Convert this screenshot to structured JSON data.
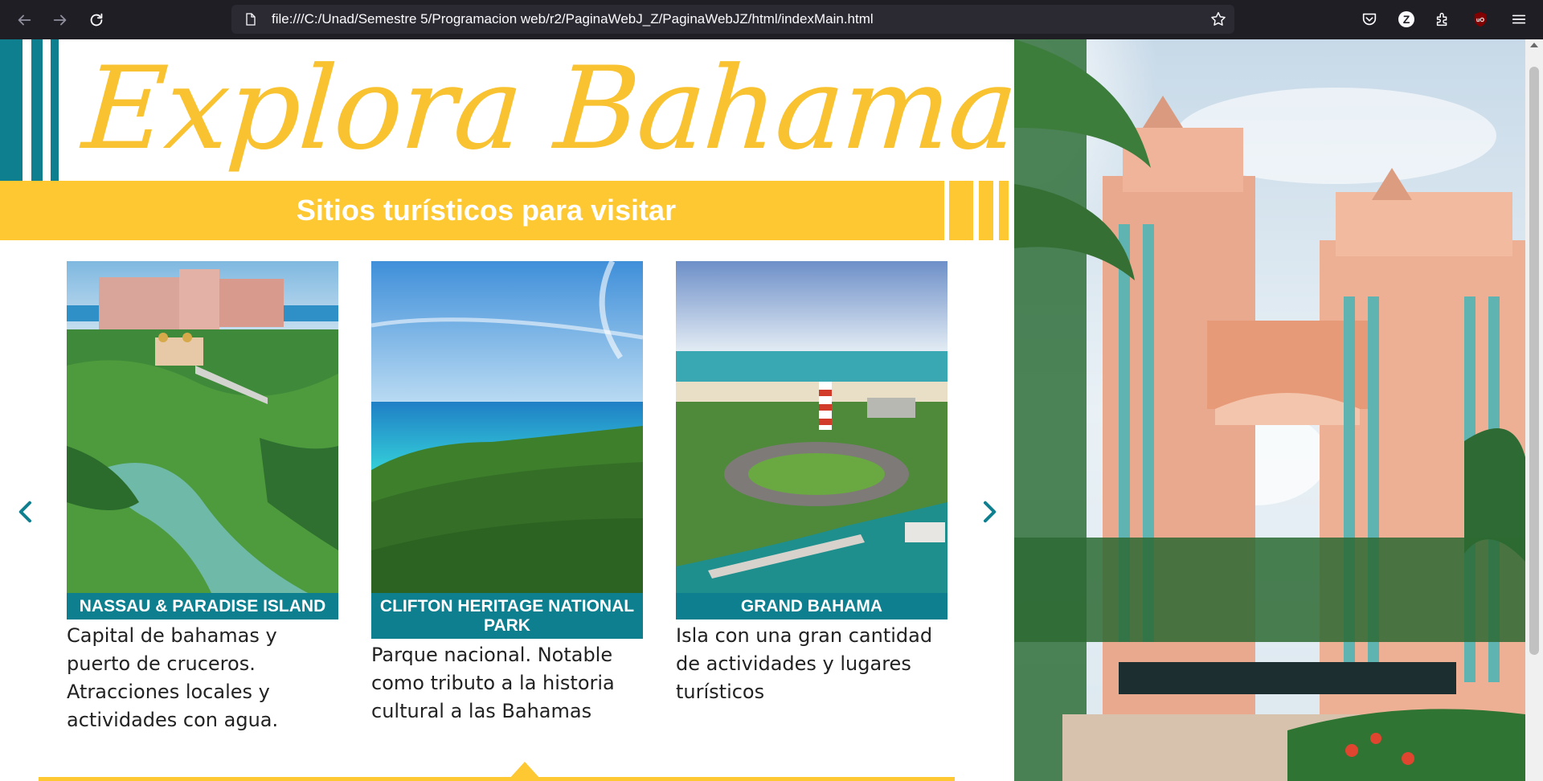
{
  "browser": {
    "url": "file:///C:/Unad/Semestre 5/Programacion web/r2/PaginaWebJ_Z/PaginaWebJZ/html/indexMain.html",
    "back_icon": "arrow-left-icon",
    "forward_icon": "arrow-right-icon",
    "reload_icon": "reload-icon",
    "bookmark_icon": "star-icon",
    "toolbar_icons": [
      "pocket-icon",
      "z-extension-icon",
      "extensions-icon",
      "ublock-icon",
      "menu-icon"
    ],
    "z_extension_letter": "Z"
  },
  "page": {
    "title": "Explora Bahamas!",
    "banner": "Sitios turísticos para visitar",
    "prev_icon": "chevron-left-icon",
    "next_icon": "chevron-right-icon",
    "cards": [
      {
        "title": "NASSAU & PARADISE ISLAND",
        "description": "Capital de bahamas y puerto de cruceros. Atracciones locales y actividades con agua."
      },
      {
        "title": "CLIFTON HERITAGE NATIONAL PARK",
        "description": "Parque nacional. Notable como tributo a la historia cultural a las Bahamas"
      },
      {
        "title": "GRAND BAHAMA",
        "description": "Isla con una gran cantidad de actividades y lugares turísticos"
      }
    ]
  },
  "colors": {
    "brand_yellow": "#fdc832",
    "title_yellow": "#f8c231",
    "teal": "#0d7f8f",
    "chrome_bg": "#1f1e25",
    "urlbar_bg": "#2b2a33"
  }
}
